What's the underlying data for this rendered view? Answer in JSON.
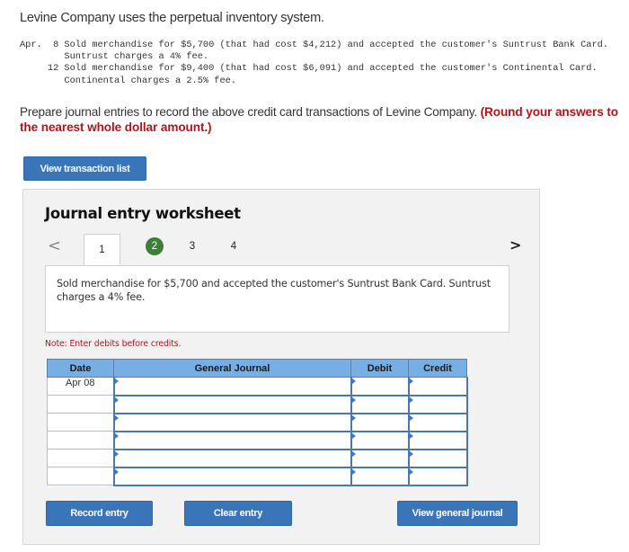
{
  "problem": {
    "intro": "Levine Company uses the perpetual inventory system.",
    "transactions_text": "Apr.  8 Sold merchandise for $5,700 (that had cost $4,212) and accepted the customer's Suntrust Bank Card.\n        Suntrust charges a 4% fee.\n     12 Sold merchandise for $9,400 (that had cost $6,091) and accepted the customer's Continental Card.\n        Continental charges a 2.5% fee.",
    "transactions": [
      {
        "month": "Apr.",
        "day": "8",
        "text": "Sold merchandise for $5,700 (that had cost $4,212) and accepted the customer's Suntrust Bank Card.",
        "fee_text": "Suntrust charges a 4% fee."
      },
      {
        "month": "",
        "day": "12",
        "text": "Sold merchandise for $9,400 (that had cost $6,091) and accepted the customer's Continental Card.",
        "fee_text": "Continental charges a 2.5% fee."
      }
    ],
    "prompt": "Prepare journal entries to record the above credit card transactions of Levine Company. ",
    "prompt_emphasis": "(Round your answers to the nearest whole dollar amount.)"
  },
  "buttons": {
    "view_transaction_list": "View transaction list",
    "record_entry": "Record entry",
    "clear_entry": "Clear entry",
    "view_general_journal": "View general journal"
  },
  "worksheet": {
    "title": "Journal entry worksheet",
    "nav_prev": "<",
    "nav_next": ">",
    "tabs": [
      {
        "label": "1",
        "state": "active"
      },
      {
        "label": "2",
        "state": "completed"
      },
      {
        "label": "3",
        "state": "default"
      },
      {
        "label": "4",
        "state": "default"
      }
    ],
    "description": "Sold merchandise for $5,700 and accepted the customer's Suntrust Bank Card. Suntrust charges a 4% fee.",
    "note": "Note: Enter debits before credits.",
    "table": {
      "headers": [
        "Date",
        "General Journal",
        "Debit",
        "Credit"
      ],
      "rows": [
        {
          "date": "Apr 08",
          "account": "",
          "debit": "",
          "credit": ""
        },
        {
          "date": "",
          "account": "",
          "debit": "",
          "credit": ""
        },
        {
          "date": "",
          "account": "",
          "debit": "",
          "credit": ""
        },
        {
          "date": "",
          "account": "",
          "debit": "",
          "credit": ""
        },
        {
          "date": "",
          "account": "",
          "debit": "",
          "credit": ""
        },
        {
          "date": "",
          "account": "",
          "debit": "",
          "credit": ""
        }
      ]
    }
  },
  "colors": {
    "button_blue": "#3a75b9",
    "header_blue": "#77aee3",
    "emphasis_red": "#b0151c",
    "completed_green": "#3f7d3a"
  }
}
